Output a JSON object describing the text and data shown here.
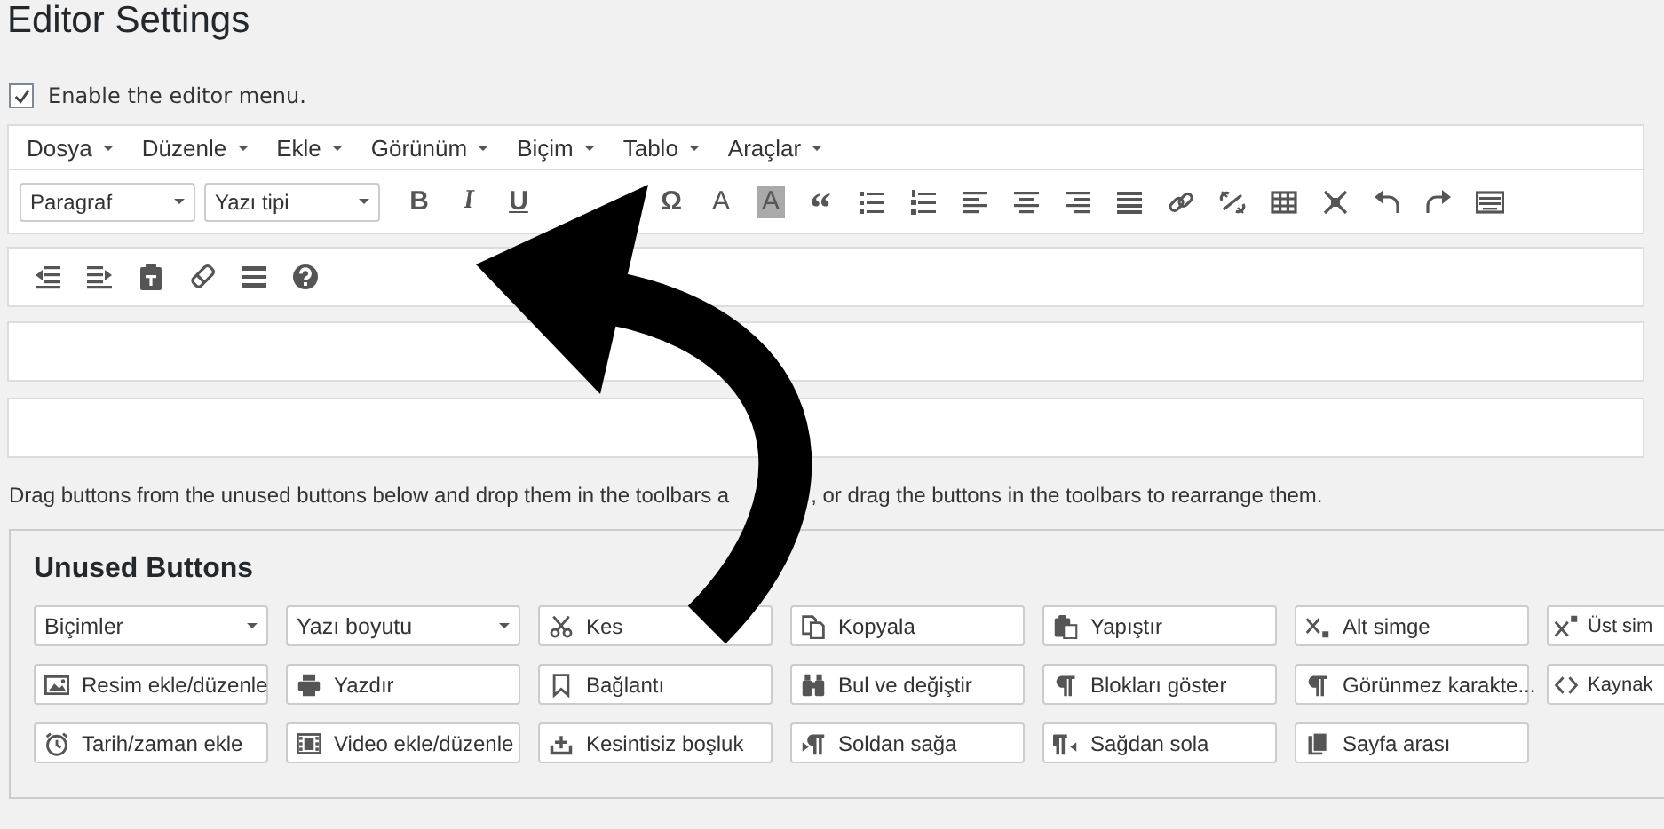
{
  "page_title": "Editor Settings",
  "editor_menu": {
    "label": "Enable the editor menu.",
    "checked": true
  },
  "menubar": [
    {
      "label": "Dosya"
    },
    {
      "label": "Düzenle"
    },
    {
      "label": "Ekle"
    },
    {
      "label": "Görünüm"
    },
    {
      "label": "Biçim"
    },
    {
      "label": "Tablo"
    },
    {
      "label": "Araçlar"
    }
  ],
  "toolbar_1": {
    "dropdowns": [
      {
        "label": "Paragraf"
      },
      {
        "label": "Yazı tipi"
      }
    ],
    "items": [
      {
        "kind": "glyph",
        "text": "B"
      },
      {
        "kind": "glyph",
        "text": "I"
      },
      {
        "kind": "glyph",
        "text": "U"
      },
      {
        "kind": "glyph",
        "text": "Ω"
      },
      {
        "kind": "glyph",
        "text": "A"
      },
      {
        "kind": "highlight",
        "text": "A"
      },
      {
        "kind": "glyph",
        "text": "“"
      },
      {
        "kind": "icon"
      },
      {
        "kind": "icon"
      },
      {
        "kind": "icon"
      },
      {
        "kind": "icon"
      },
      {
        "kind": "icon"
      },
      {
        "kind": "icon"
      },
      {
        "kind": "icon"
      },
      {
        "kind": "icon"
      },
      {
        "kind": "icon"
      },
      {
        "kind": "icon"
      },
      {
        "kind": "icon"
      },
      {
        "kind": "icon"
      },
      {
        "kind": "icon"
      }
    ]
  },
  "description": [
    {
      "text": "Drag buttons from the unused buttons below and drop them in the toolbars a"
    },
    {
      "text": ", or drag the buttons in the toolbars to rearrange them."
    }
  ],
  "unused_buttons": {
    "title": "Unused Buttons",
    "items": [
      {
        "kind": "dropdown",
        "label": "Biçimler"
      },
      {
        "kind": "dropdown",
        "label": "Yazı boyutu"
      },
      {
        "kind": "button",
        "label": "Kes"
      },
      {
        "kind": "button",
        "label": "Kopyala"
      },
      {
        "kind": "button",
        "label": "Yapıştır"
      },
      {
        "kind": "button",
        "label": "Alt simge"
      },
      {
        "kind": "button",
        "label": "Üst sim"
      },
      {
        "kind": "button",
        "label": "Resim ekle/düzenle"
      },
      {
        "kind": "button",
        "label": "Yazdır"
      },
      {
        "kind": "button",
        "label": "Bağlantı"
      },
      {
        "kind": "button",
        "label": "Bul ve değiştir"
      },
      {
        "kind": "button",
        "label": "Blokları göster"
      },
      {
        "kind": "button",
        "label": "Görünmez karakte..."
      },
      {
        "kind": "button",
        "label": "Kaynak"
      },
      {
        "kind": "button",
        "label": "Tarih/zaman ekle"
      },
      {
        "kind": "button",
        "label": "Video ekle/düzenle"
      },
      {
        "kind": "button",
        "label": "Kesintisiz boşluk"
      },
      {
        "kind": "button",
        "label": "Soldan sağa"
      },
      {
        "kind": "button",
        "label": "Sağdan sola"
      },
      {
        "kind": "button",
        "label": "Sayfa arası"
      }
    ]
  }
}
